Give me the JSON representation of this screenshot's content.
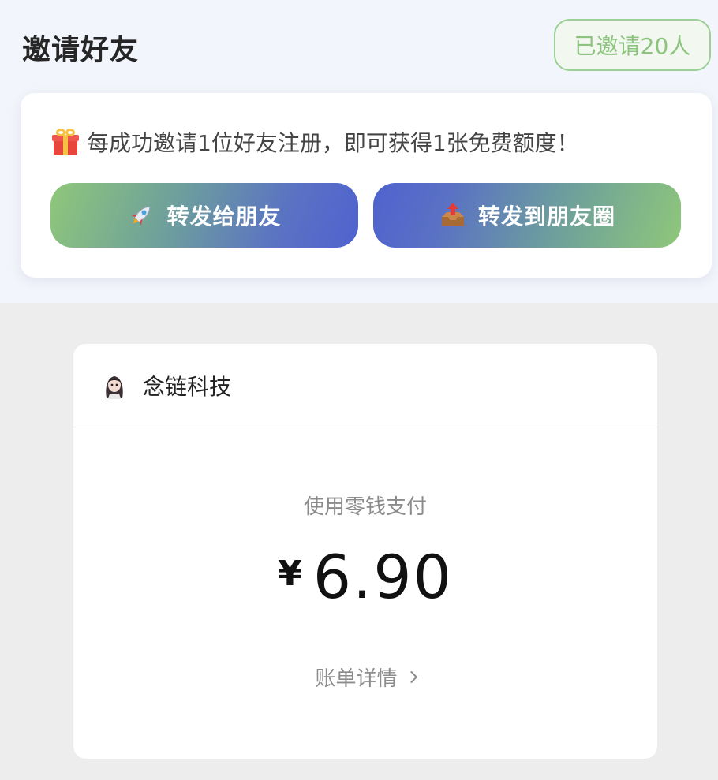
{
  "invite": {
    "title": "邀请好友",
    "invited_badge": "已邀请20人",
    "description": "每成功邀请1位好友注册，即可获得1张免费额度！",
    "buttons": {
      "forward_friend": "转发给朋友",
      "forward_moments": "转发到朋友圈"
    },
    "icons": {
      "gift": "gift-icon",
      "rocket": "rocket-icon",
      "outbox": "outbox-tray-icon"
    },
    "colors": {
      "background": "#f3f5fc",
      "badge_green": "#8cc47f",
      "gradient_green": "#8fc77a",
      "gradient_blue": "#4f62cf"
    }
  },
  "payment": {
    "merchant_name": "念链科技",
    "method": "使用零钱支付",
    "currency_symbol": "¥",
    "amount": "6.90",
    "bill_detail_link": "账单详情"
  }
}
